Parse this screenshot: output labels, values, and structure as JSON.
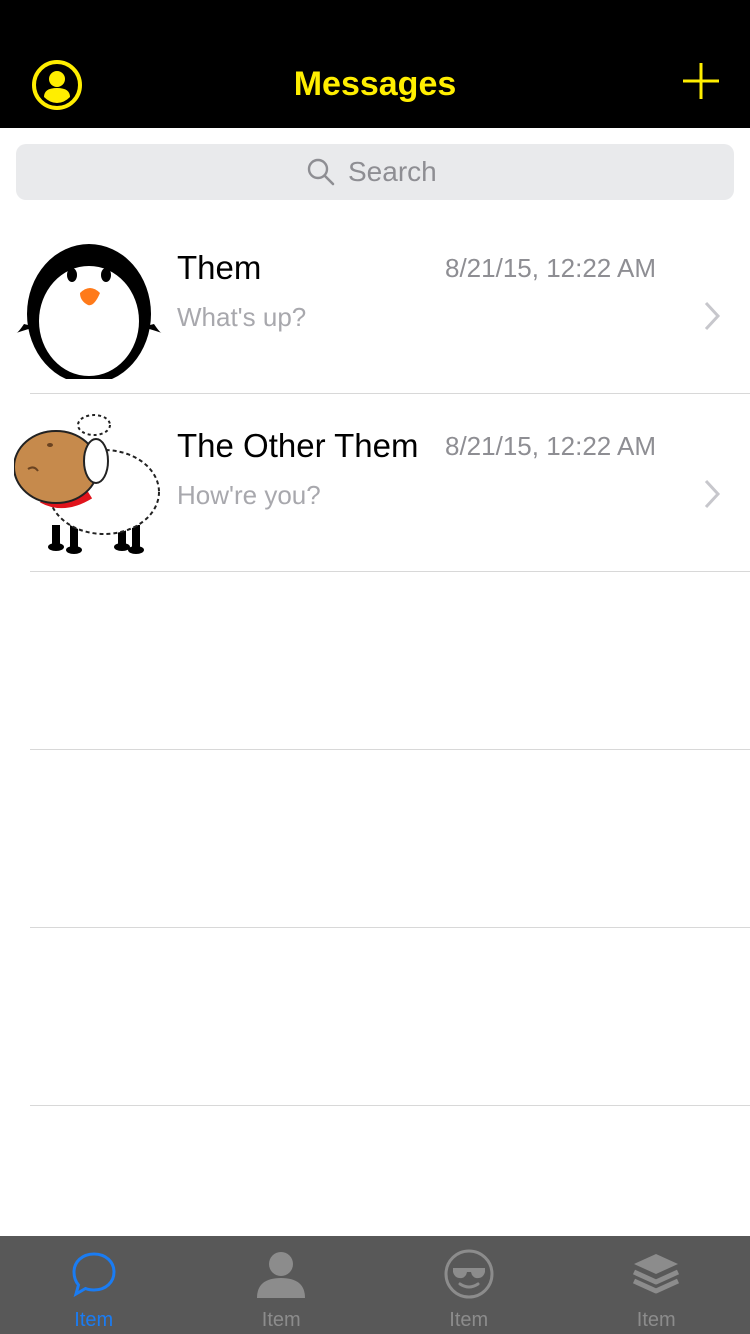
{
  "navbar": {
    "title": "Messages",
    "left_icon": "profile-circle-icon",
    "right_icon": "plus-icon",
    "accent": "#ffee00"
  },
  "search": {
    "placeholder": "Search"
  },
  "conversations": [
    {
      "name": "Them",
      "timestamp": "8/21/15, 12:22 AM",
      "preview": "What's up?",
      "avatar": "penguin"
    },
    {
      "name": "The Other Them",
      "timestamp": "8/21/15, 12:22 AM",
      "preview": "How're you?",
      "avatar": "sheep"
    }
  ],
  "tabbar": {
    "active_color": "#1a7cf3",
    "items": [
      {
        "label": "Item",
        "icon": "chat-bubble-icon",
        "active": true
      },
      {
        "label": "Item",
        "icon": "person-icon",
        "active": false
      },
      {
        "label": "Item",
        "icon": "sunglasses-face-icon",
        "active": false
      },
      {
        "label": "Item",
        "icon": "layers-icon",
        "active": false
      }
    ]
  }
}
